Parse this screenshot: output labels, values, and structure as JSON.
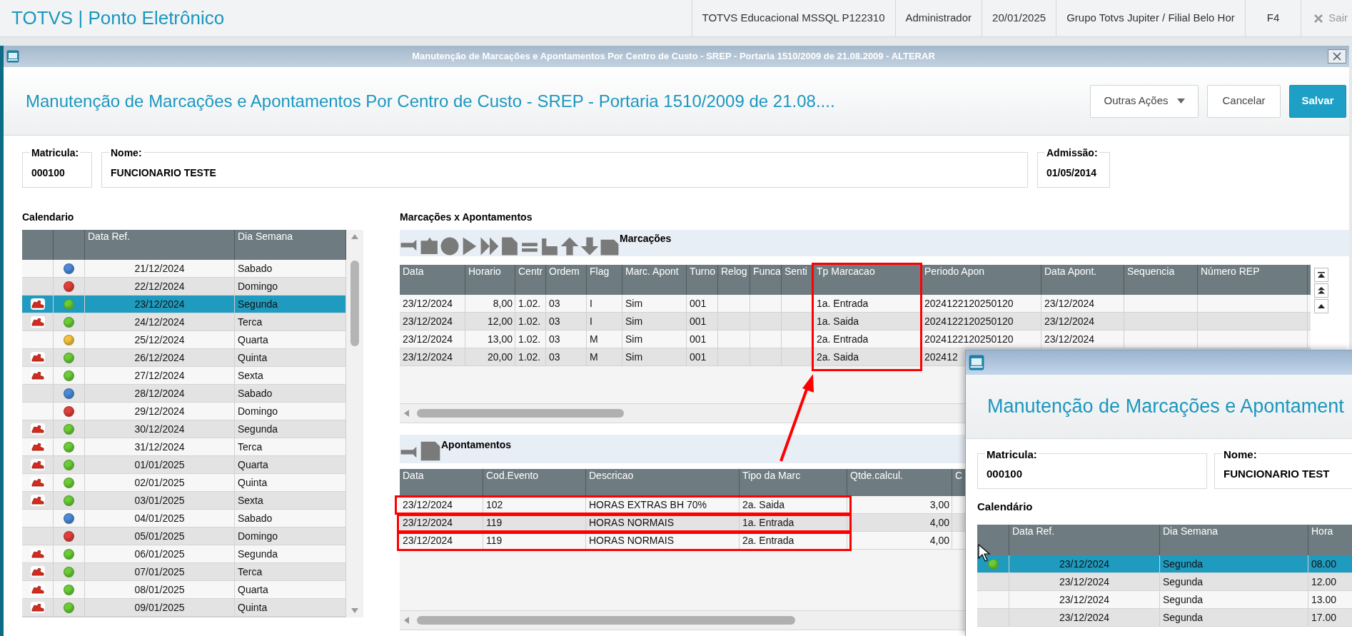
{
  "app_bar": {
    "title": "TOTVS | Ponto Eletrônico",
    "items": [
      "TOTVS Educacional MSSQL P122310",
      "Administrador",
      "20/01/2025",
      "Grupo Totvs Jupiter / Filial Belo Hor"
    ],
    "shortcut": "F4",
    "exit": "Sair"
  },
  "window": {
    "title": "Manutenção de Marcações e Apontamentos Por Centro de Custo - SREP - Portaria 1510/2009 de 21.08.2009 - ALTERAR"
  },
  "header": {
    "title": "Manutenção de Marcações e Apontamentos Por Centro de Custo - SREP - Portaria 1510/2009 de 21.08....",
    "buttons": [
      {
        "label": "Outras Ações",
        "kind": "menu"
      },
      {
        "label": "Cancelar",
        "kind": "secondary"
      },
      {
        "label": "Salvar",
        "kind": "primary"
      }
    ]
  },
  "fields": [
    {
      "label": "Matricula:",
      "value": "000100"
    },
    {
      "label": "Nome:",
      "value": "FUNCIONARIO TESTE"
    },
    {
      "label": "Admissão:",
      "value": "01/05/2014"
    }
  ],
  "calendar": {
    "title": "Calendario",
    "columns": [
      "Data Ref.",
      "Dia Semana"
    ],
    "rows": [
      {
        "marked": false,
        "color": "#4a8ad6",
        "date": "21/12/2024",
        "weekday": "Sabado",
        "selected": false
      },
      {
        "marked": false,
        "color": "#e0403a",
        "date": "22/12/2024",
        "weekday": "Domingo",
        "selected": false
      },
      {
        "marked": true,
        "color": "#6acd36",
        "date": "23/12/2024",
        "weekday": "Segunda",
        "selected": true
      },
      {
        "marked": true,
        "color": "#6acd36",
        "date": "24/12/2024",
        "weekday": "Terca",
        "selected": false
      },
      {
        "marked": false,
        "color": "#f2c23c",
        "date": "25/12/2024",
        "weekday": "Quarta",
        "selected": false
      },
      {
        "marked": true,
        "color": "#6acd36",
        "date": "26/12/2024",
        "weekday": "Quinta",
        "selected": false
      },
      {
        "marked": true,
        "color": "#6acd36",
        "date": "27/12/2024",
        "weekday": "Sexta",
        "selected": false
      },
      {
        "marked": false,
        "color": "#4a8ad6",
        "date": "28/12/2024",
        "weekday": "Sabado",
        "selected": false
      },
      {
        "marked": false,
        "color": "#e0403a",
        "date": "29/12/2024",
        "weekday": "Domingo",
        "selected": false
      },
      {
        "marked": true,
        "color": "#6acd36",
        "date": "30/12/2024",
        "weekday": "Segunda",
        "selected": false
      },
      {
        "marked": true,
        "color": "#6acd36",
        "date": "31/12/2024",
        "weekday": "Terca",
        "selected": false
      },
      {
        "marked": true,
        "color": "#6acd36",
        "date": "01/01/2025",
        "weekday": "Quarta",
        "selected": false
      },
      {
        "marked": true,
        "color": "#6acd36",
        "date": "02/01/2025",
        "weekday": "Quinta",
        "selected": false
      },
      {
        "marked": true,
        "color": "#6acd36",
        "date": "03/01/2025",
        "weekday": "Sexta",
        "selected": false
      },
      {
        "marked": false,
        "color": "#4a8ad6",
        "date": "04/01/2025",
        "weekday": "Sabado",
        "selected": false
      },
      {
        "marked": false,
        "color": "#e0403a",
        "date": "05/01/2025",
        "weekday": "Domingo",
        "selected": false
      },
      {
        "marked": true,
        "color": "#6acd36",
        "date": "06/01/2025",
        "weekday": "Segunda",
        "selected": false
      },
      {
        "marked": true,
        "color": "#6acd36",
        "date": "07/01/2025",
        "weekday": "Terca",
        "selected": false
      },
      {
        "marked": true,
        "color": "#6acd36",
        "date": "08/01/2025",
        "weekday": "Quarta",
        "selected": false
      },
      {
        "marked": true,
        "color": "#6acd36",
        "date": "09/01/2025",
        "weekday": "Quinta",
        "selected": false
      }
    ]
  },
  "details": {
    "title": "Marcações x Apontamentos",
    "marcacoes": {
      "title": "Marcações",
      "columns": [
        {
          "label": "Data",
          "kind": "text"
        },
        {
          "label": "Horario",
          "kind": "number"
        },
        {
          "label": "Centr",
          "kind": "text"
        },
        {
          "label": "Ordem",
          "kind": "text"
        },
        {
          "label": "Flag",
          "kind": "text"
        },
        {
          "label": "Marc. Apont",
          "kind": "text"
        },
        {
          "label": "Turno",
          "kind": "text"
        },
        {
          "label": "Relog",
          "kind": "text"
        },
        {
          "label": "Funca",
          "kind": "text"
        },
        {
          "label": "Senti",
          "kind": "text"
        },
        {
          "label": "Tp Marcacao",
          "kind": "text"
        },
        {
          "label": "Periodo Apon",
          "kind": "text"
        },
        {
          "label": "Data Apont.",
          "kind": "text"
        },
        {
          "label": "Sequencia",
          "kind": "text"
        },
        {
          "label": "Número REP",
          "kind": "text"
        }
      ],
      "rows": [
        [
          "23/12/2024",
          "8,00",
          "1.02.",
          "03",
          "I",
          "Sim",
          "001",
          null,
          null,
          null,
          "1a. Entrada",
          "2024122120250120",
          "23/12/2024",
          null,
          null
        ],
        [
          "23/12/2024",
          "12,00",
          "1.02.",
          "03",
          "I",
          "Sim",
          "001",
          null,
          null,
          null,
          "1a. Saida",
          "2024122120250120",
          "23/12/2024",
          null,
          null
        ],
        [
          "23/12/2024",
          "13,00",
          "1.02.",
          "03",
          "M",
          "Sim",
          "001",
          null,
          null,
          null,
          "2a. Entrada",
          "2024122120250120",
          "23/12/2024",
          null,
          null
        ],
        [
          "23/12/2024",
          "20,00",
          "1.02.",
          "03",
          "M",
          "Sim",
          "001",
          null,
          null,
          null,
          "2a. Saida",
          "202412"
        ]
      ]
    },
    "apontamentos": {
      "title": "Apontamentos",
      "columns": [
        {
          "label": "Data",
          "kind": "text"
        },
        {
          "label": "Cod.Evento",
          "kind": "text"
        },
        {
          "label": "Descricao",
          "kind": "text"
        },
        {
          "label": "Tipo da Marc",
          "kind": "text"
        },
        {
          "label": "Qtde.calcul.",
          "kind": "number"
        },
        {
          "label": "C",
          "kind": "text"
        }
      ],
      "rows": [
        [
          "23/12/2024",
          "102",
          "HORAS EXTRAS BH 70%",
          "2a. Saida",
          "3,00",
          null
        ],
        [
          "23/12/2024",
          "119",
          "HORAS NORMAIS",
          "1a. Entrada",
          "4,00",
          null
        ],
        [
          "23/12/2024",
          "119",
          "HORAS NORMAIS",
          "2a. Entrada",
          "4,00",
          null
        ]
      ]
    }
  },
  "popup": {
    "title": "Manutenção de Marcações e Apontament",
    "fields": [
      {
        "label": "Matricula:",
        "value": "000100"
      },
      {
        "label": "Nome:",
        "value": "FUNCIONARIO TEST"
      }
    ],
    "calendar": {
      "title": "Calendário",
      "columns": [
        "Data Ref.",
        "Dia Semana",
        "Hora"
      ],
      "rows": [
        {
          "color": "#6acd36",
          "date": "23/12/2024",
          "weekday": "Segunda",
          "hour": "08.00",
          "selected": true
        },
        {
          "date": "23/12/2024",
          "weekday": "Segunda",
          "hour": "12.00",
          "selected": false
        },
        {
          "date": "23/12/2024",
          "weekday": "Segunda",
          "hour": "13.00",
          "selected": false
        },
        {
          "date": "23/12/2024",
          "weekday": "Segunda",
          "hour": "17.00",
          "selected": false
        }
      ]
    }
  }
}
